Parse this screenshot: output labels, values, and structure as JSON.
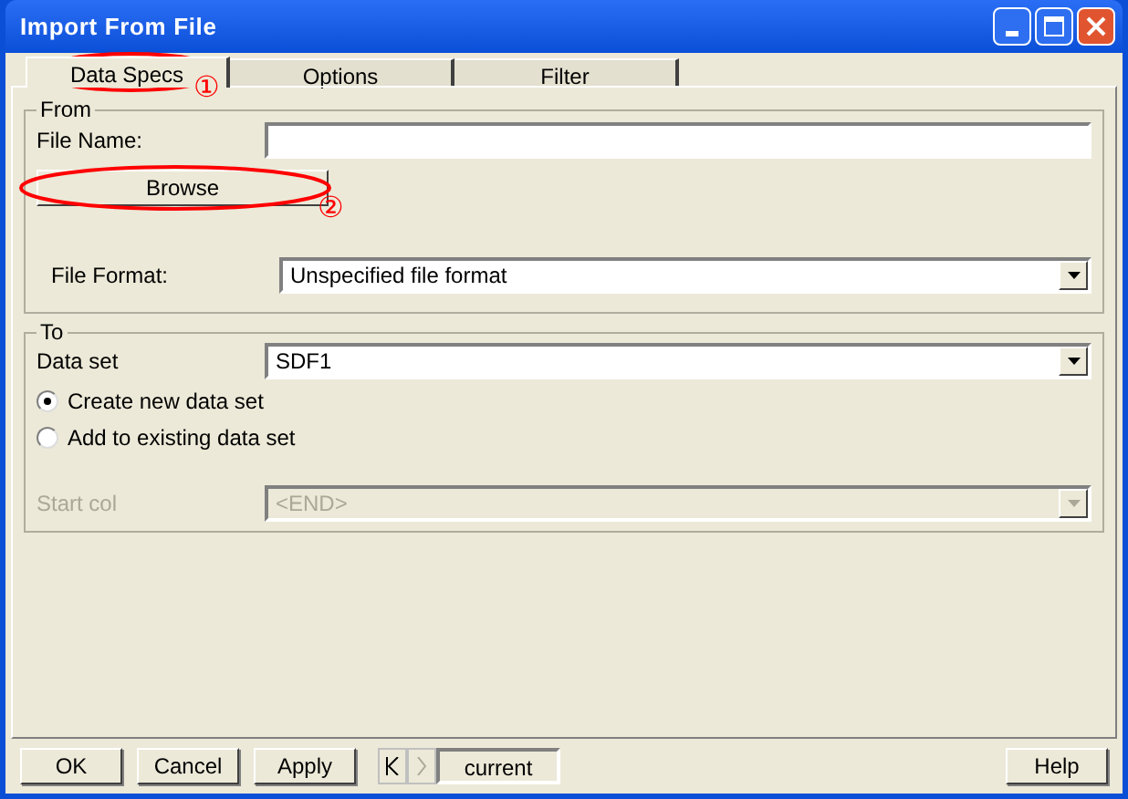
{
  "window": {
    "title": "Import From File"
  },
  "tabs": [
    {
      "label": "Data Specs",
      "selected": true
    },
    {
      "label": "Options",
      "selected": false
    },
    {
      "label": "Filter",
      "selected": false
    }
  ],
  "from": {
    "label": "From",
    "file_name": {
      "label": "File Name:"
    },
    "browse_button": "Browse",
    "file_format": {
      "label": "File Format:",
      "value": "Unspecified file format"
    }
  },
  "to": {
    "label": "To",
    "data_set": {
      "label": "Data set",
      "value": "SDF1"
    },
    "options": [
      {
        "label": "Create new data set",
        "selected": true
      },
      {
        "label": "Add to existing data set",
        "selected": false
      }
    ],
    "start_col": {
      "label": "Start col",
      "value": "<END>",
      "disabled": true
    }
  },
  "annotations": [
    "①",
    "②"
  ],
  "footer": {
    "buttons": [
      "OK",
      "Cancel",
      "Apply"
    ],
    "next_disabled": true,
    "current": "current",
    "help": "Help"
  }
}
